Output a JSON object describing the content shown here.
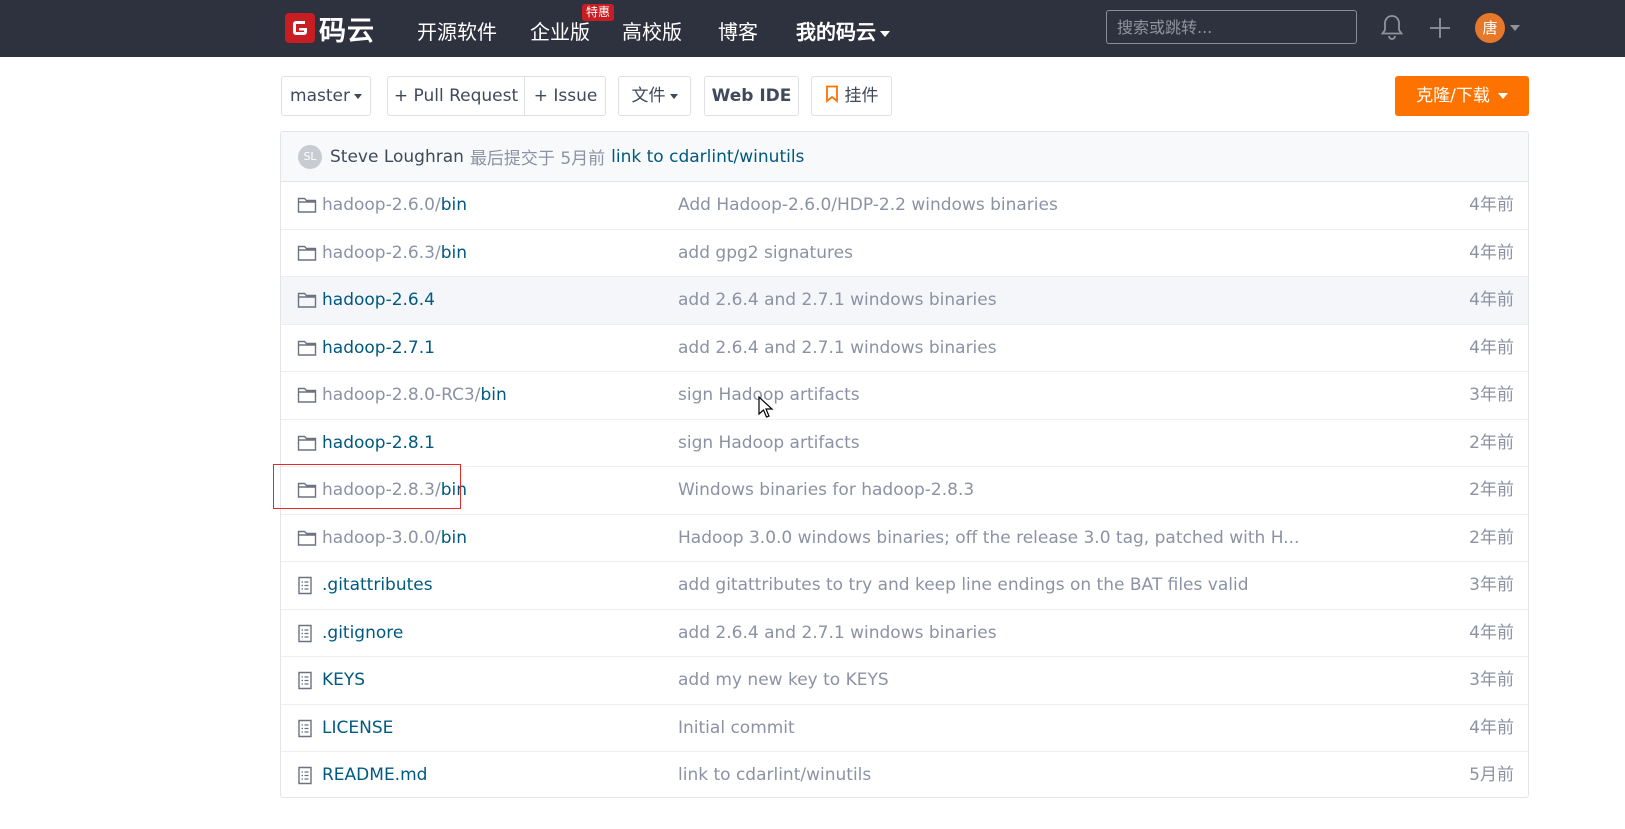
{
  "nav": {
    "logo_text": "码云",
    "items": [
      "开源软件",
      "企业版",
      "高校版",
      "博客",
      "我的码云"
    ],
    "badge": "特惠",
    "search_placeholder": "搜索或跳转...",
    "avatar_text": "唐"
  },
  "toolbar": {
    "branch": "master",
    "pull_request": "+ Pull Request",
    "issue": "+ Issue",
    "files": "文件",
    "web_ide": "Web IDE",
    "widget": "挂件",
    "clone": "克隆/下载"
  },
  "commit": {
    "avatar": "SL",
    "author": "Steve Loughran",
    "meta": "最后提交于 5月前",
    "message": "link to cdarlint/winutils"
  },
  "files": [
    {
      "type": "folder",
      "prefix": "hadoop-2.6.0/",
      "name": "bin",
      "message": "Add Hadoop-2.6.0/HDP-2.2 windows binaries",
      "time": "4年前"
    },
    {
      "type": "folder",
      "prefix": "hadoop-2.6.3/",
      "name": "bin",
      "message": "add gpg2 signatures",
      "time": "4年前"
    },
    {
      "type": "folder",
      "prefix": "",
      "name": "hadoop-2.6.4",
      "message": "add 2.6.4 and 2.7.1 windows binaries",
      "time": "4年前"
    },
    {
      "type": "folder",
      "prefix": "",
      "name": "hadoop-2.7.1",
      "message": "add 2.6.4 and 2.7.1 windows binaries",
      "time": "4年前"
    },
    {
      "type": "folder",
      "prefix": "hadoop-2.8.0-RC3/",
      "name": "bin",
      "message": "sign Hadoop artifacts",
      "time": "3年前"
    },
    {
      "type": "folder",
      "prefix": "",
      "name": "hadoop-2.8.1",
      "message": "sign Hadoop artifacts",
      "time": "2年前"
    },
    {
      "type": "folder",
      "prefix": "hadoop-2.8.3/",
      "name": "bin",
      "message": "Windows binaries for hadoop-2.8.3",
      "time": "2年前"
    },
    {
      "type": "folder",
      "prefix": "hadoop-3.0.0/",
      "name": "bin",
      "message": "Hadoop 3.0.0 windows binaries; off the release 3.0 tag, patched with H...",
      "time": "2年前"
    },
    {
      "type": "file",
      "prefix": "",
      "name": ".gitattributes",
      "message": "add gitattributes to try and keep line endings on the BAT files valid",
      "time": "3年前"
    },
    {
      "type": "file",
      "prefix": "",
      "name": ".gitignore",
      "message": "add 2.6.4 and 2.7.1 windows binaries",
      "time": "4年前"
    },
    {
      "type": "file",
      "prefix": "",
      "name": "KEYS",
      "message": "add my new key to KEYS",
      "time": "3年前"
    },
    {
      "type": "file",
      "prefix": "",
      "name": "LICENSE",
      "message": "Initial commit",
      "time": "4年前"
    },
    {
      "type": "file",
      "prefix": "",
      "name": "README.md",
      "message": "link to cdarlint/winutils",
      "time": "5月前"
    }
  ]
}
